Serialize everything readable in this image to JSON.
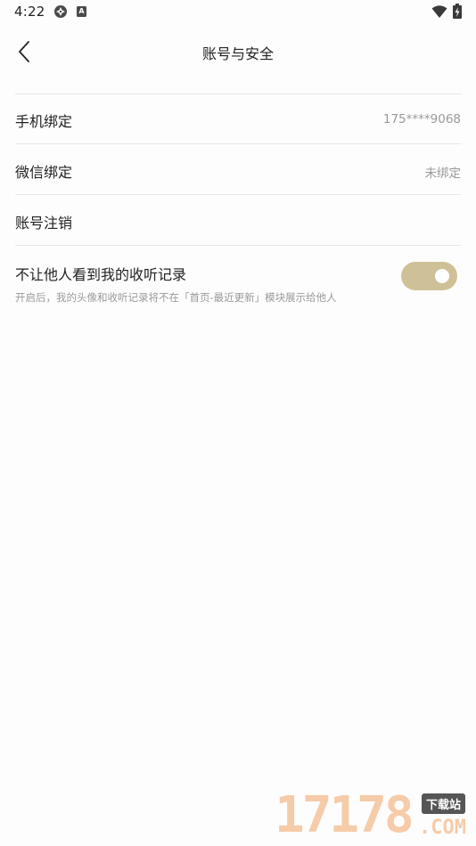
{
  "status_bar": {
    "time": "4:22",
    "notification_badge": "A"
  },
  "header": {
    "title": "账号与安全"
  },
  "settings": {
    "items": [
      {
        "label": "手机绑定",
        "value": "175****9068"
      },
      {
        "label": "微信绑定",
        "value": "未绑定"
      },
      {
        "label": "账号注销",
        "value": ""
      }
    ],
    "privacy": {
      "title": "不让他人看到我的收听记录",
      "description": "开启后，我的头像和收听记录将不在「首页-最近更新」模块展示给他人",
      "enabled": true
    }
  },
  "watermark": {
    "number": "17178",
    "tag": "下载站",
    "suffix": ".COM"
  },
  "colors": {
    "toggle_on": "#cfc197",
    "divider": "#e6e6e6",
    "secondary_text": "#9a9a9a"
  }
}
